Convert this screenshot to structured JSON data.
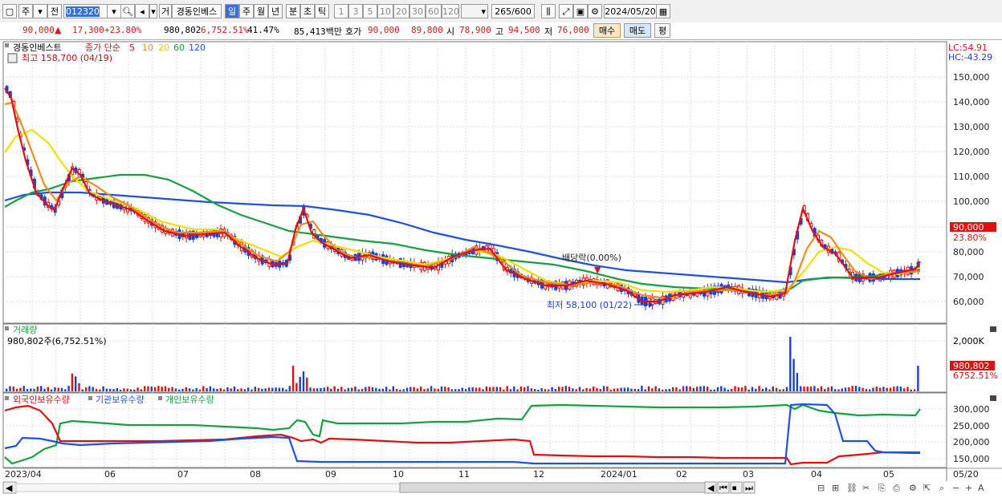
{
  "toolbar": {
    "market_label": "주",
    "jeon_label": "전",
    "stock_code": "012320",
    "type_label": "거",
    "stock_name": "경동인베스",
    "periods": [
      "일",
      "주",
      "월",
      "년",
      "분",
      "초",
      "틱"
    ],
    "active_period": "일",
    "minute_options": [
      "1",
      "3",
      "5",
      "10",
      "20",
      "30",
      "60",
      "120"
    ],
    "count_display": "265/600",
    "date": "2024/05/20"
  },
  "quote": {
    "price": "90,000",
    "change": "17,300",
    "change_pct": "+23.80%",
    "volume": "980,802",
    "volume_pct": "6,752.51%",
    "turnover_pct": "41.47%",
    "amount": "85,413백만",
    "hoga_label": "호가",
    "ask": "90,000",
    "bid": "89,800",
    "open_label": "시",
    "open": "78,900",
    "high_label": "고",
    "high": "94,500",
    "low_label": "저",
    "low": "76,000",
    "buy_button": "매수",
    "sell_button": "매도",
    "eval_button": "평"
  },
  "price_panel": {
    "legend_name": "경동인베스트",
    "legend_ma": "종가 단순",
    "ma_periods": [
      "5",
      "10",
      "20",
      "60",
      "120"
    ],
    "ma_colors": [
      "#e01010",
      "#f08c1e",
      "#f0e000",
      "#18a040",
      "#2050e0"
    ],
    "max_label": "최고 158,700 (04/19)",
    "min_label": "최저 58,100 (01/22)",
    "annotation": "배당락(0.00%)",
    "lc": "LC:54.91",
    "hc": "HC:-43.29",
    "current_price_tag": "90,000",
    "current_pct_tag": "23.80%",
    "y_ticks": [
      "150,000",
      "140,000",
      "130,000",
      "120,000",
      "110,000",
      "100,000",
      "80,000",
      "70,000",
      "60,000"
    ]
  },
  "volume_panel": {
    "title": "거래량",
    "value_label": "980,802주(6,752.51%)",
    "y_ticks": [
      "2,000K",
      "1,000K"
    ],
    "current_tag": "980,802",
    "current_pct_tag": "6752.51%"
  },
  "holdings_panel": {
    "series": [
      "외국인보유수량",
      "기관보유수량",
      "개인보유수량"
    ],
    "colors": [
      "#e01010",
      "#2050e0",
      "#18a040"
    ],
    "y_ticks": [
      "300,000",
      "250,000",
      "200,000",
      "150,000"
    ]
  },
  "x_axis": {
    "labels": [
      "2023/04",
      "06",
      "07",
      "08",
      "09",
      "10",
      "11",
      "12",
      "2024/01",
      "02",
      "03",
      "04",
      "05",
      "05/20"
    ]
  },
  "bottom_controls": [
    "◀",
    "⏮",
    "⏹",
    "⏭"
  ]
}
